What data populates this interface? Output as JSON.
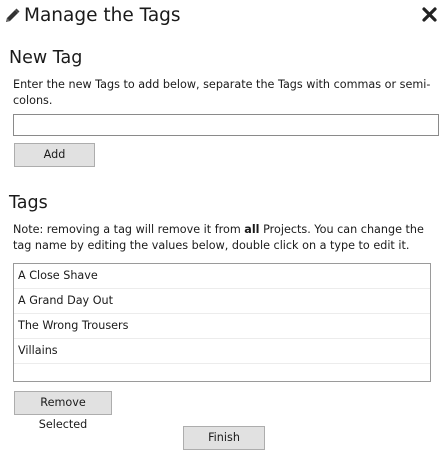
{
  "dialog": {
    "title": "Manage the Tags",
    "title_icon": "pencil-icon",
    "close_icon": "close-icon"
  },
  "new_tag": {
    "heading": "New Tag",
    "hint": "Enter the new Tags to add below, separate the Tags with commas or semi-colons.",
    "input_value": "",
    "input_placeholder": "",
    "add_label": "Add"
  },
  "tags": {
    "heading": "Tags",
    "note_prefix": "Note: removing a tag will remove it from ",
    "note_bold": "all",
    "note_suffix": " Projects. You can change the tag name by editing the values below, double click on a type to edit it.",
    "items": [
      {
        "label": "A Close Shave"
      },
      {
        "label": "A Grand Day Out"
      },
      {
        "label": "The Wrong Trousers"
      },
      {
        "label": "Villains"
      },
      {
        "label": ""
      }
    ],
    "remove_label": "Remove Selected"
  },
  "footer": {
    "finish_label": "Finish"
  },
  "colors": {
    "button_bg": "#e1e1e1",
    "button_border": "#adadad",
    "text": "#1a1a1a"
  }
}
